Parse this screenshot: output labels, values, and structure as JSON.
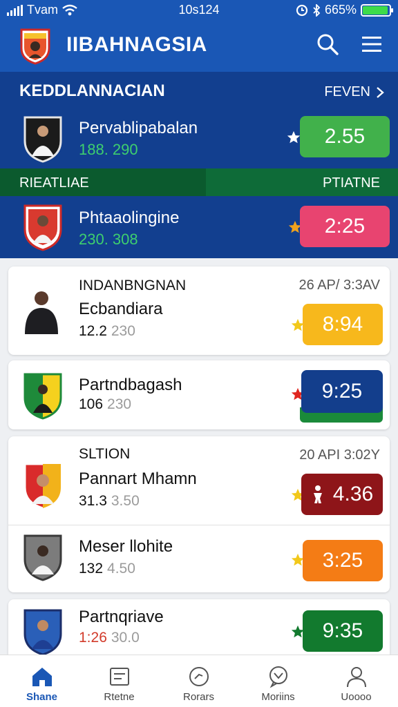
{
  "status_bar": {
    "carrier": "Tvam",
    "time": "10s124",
    "battery": "665%",
    "battery_level": 0.9
  },
  "header": {
    "title": "IIBAHNAGSIA"
  },
  "featured": {
    "section_title": "KEDDLANNACIAN",
    "section_link": "FEVEN",
    "top_match": {
      "name": "Pervablipabalan",
      "stat": "188. 290",
      "odds": "2.55"
    },
    "bar": {
      "left": "RIEATLIAE",
      "right": "PTIATNE"
    },
    "second_match": {
      "name": "Phtaaolingine",
      "stat": "230. 308",
      "odds": "2:25"
    }
  },
  "cards": [
    {
      "caption": "INDANBNGNAN",
      "date": "26 AP/ 3:3AV",
      "name": "Ecbandiara",
      "stat": "12.2",
      "stat_muted": "230",
      "odds": "8:94",
      "odds_color": "#f7b81c"
    },
    {
      "caption": "",
      "date": "",
      "name": "Partndbagash",
      "stat": "106",
      "stat_muted": "230",
      "odds": "9:25",
      "odds_color": "#133e8c"
    },
    {
      "caption": "SLTION",
      "date": "20 API 3:02Y",
      "name": "Pannart Mhamn",
      "stat": "31.3",
      "stat_muted": "3.50",
      "odds": "4.36",
      "odds_color": "#8e1519"
    },
    {
      "caption": "",
      "date": "",
      "name": "Meser llohite",
      "stat": "132",
      "stat_muted": "4.50",
      "odds": "3:25",
      "odds_color": "#f47c15"
    },
    {
      "caption": "",
      "date": "",
      "name": "Partnqriave",
      "stat": "1:26",
      "stat_muted": "30.0",
      "odds": "9:35",
      "odds_color": "#127a2e"
    }
  ],
  "nav": [
    {
      "label": "Shane",
      "icon": "home-icon"
    },
    {
      "label": "Rtetne",
      "icon": "ticket-icon"
    },
    {
      "label": "Rorars",
      "icon": "clock-icon"
    },
    {
      "label": "Moriins",
      "icon": "chat-icon"
    },
    {
      "label": "Uoooo",
      "icon": "user-icon"
    }
  ],
  "colors": {
    "primary": "#1a57b5",
    "featured_bg": "#123f8f",
    "green": "#41b14b",
    "pink": "#e84470"
  }
}
